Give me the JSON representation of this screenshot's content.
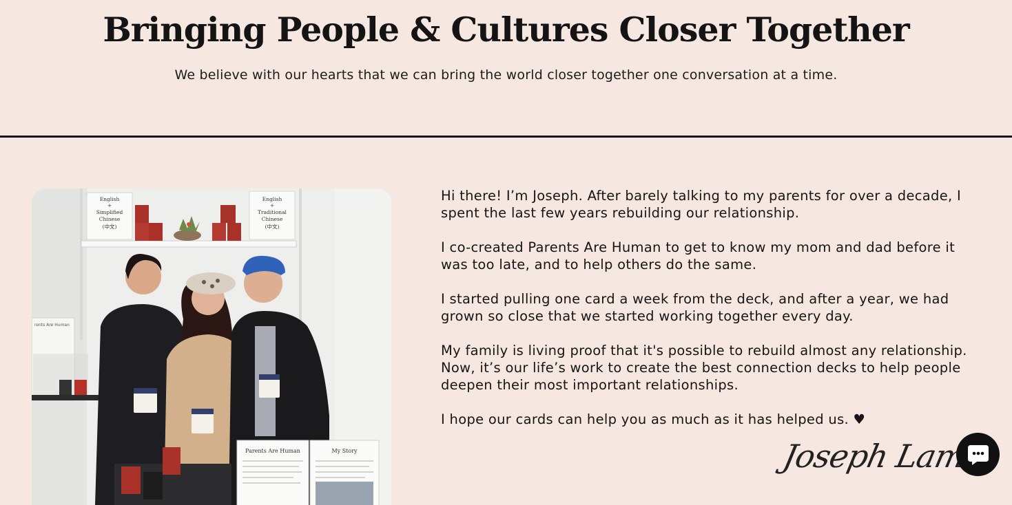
{
  "hero": {
    "title": "Bringing People & Cultures Closer Together",
    "subtitle": "We believe with our hearts that we can bring the world closer together one conversation at a time."
  },
  "story": {
    "paragraphs": [
      "Hi there! I’m Joseph. After barely talking to my parents for over a decade, I spent the last few years rebuilding our relationship.",
      "I co-created Parents Are Human to get to know my mom and dad before it was too late, and to help others do the same.",
      "I started pulling one card a week from the deck, and after a year, we had grown so close that we started working together every day.",
      "My family is living proof that it's possible to rebuild almost any relationship. Now, it’s our life’s work to create the best connection decks to help people deepen their most important relationships.",
      "I hope our cards can help you as much as it has helped us. ♥"
    ],
    "signature": "Joseph Lam"
  },
  "photo": {
    "sign_left": [
      "English",
      "+",
      "Simplified",
      "Chinese",
      "(中文)"
    ],
    "sign_right": [
      "English",
      "+",
      "Traditional",
      "Chinese",
      "(中文)"
    ],
    "table_card_title": "Parents Are Human",
    "my_story_title": "My Story",
    "side_card_text": "rents Are Human"
  },
  "chat": {
    "icon": "chat-bubble-icon"
  },
  "colors": {
    "background": "#f6e8e1",
    "text": "#151515",
    "chat_button": "#111111"
  }
}
